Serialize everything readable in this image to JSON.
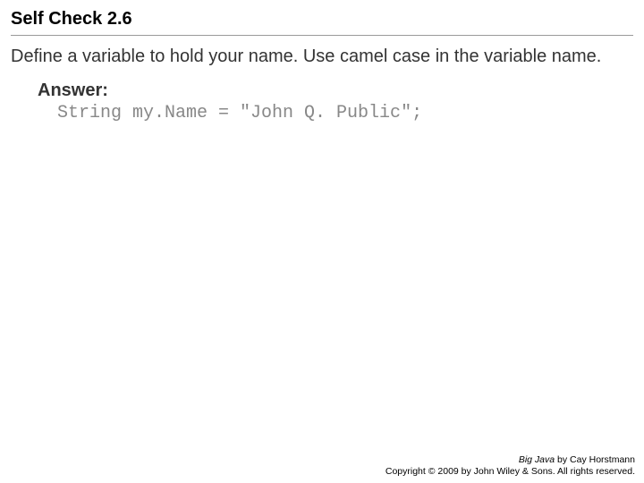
{
  "title": "Self Check 2.6",
  "question": "Define a variable to hold your name. Use camel case in the variable name.",
  "answer": {
    "label": "Answer:",
    "code": "String my.Name = \"John Q. Public\";"
  },
  "footer": {
    "book_title": "Big Java",
    "byline": " by Cay Horstmann",
    "copyright": "Copyright © 2009 by John Wiley & Sons. All rights reserved."
  }
}
